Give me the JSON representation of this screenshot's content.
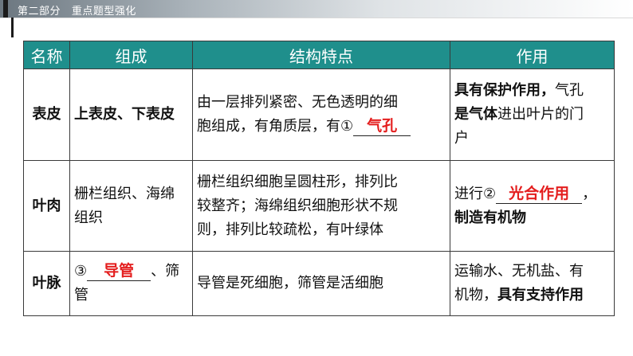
{
  "header": {
    "section": "第二部分",
    "subtitle": "重点题型强化"
  },
  "table": {
    "columns": [
      "名称",
      "组成",
      "结构特点",
      "作用"
    ],
    "rows": [
      {
        "name": "表皮",
        "composition": "上表皮、下表皮",
        "structure_line1": "由一层排列紧密、无色透明的细",
        "structure_line2_prefix": "胞组成，有角质层，有①",
        "structure_answer": "气孔",
        "function_p1": "具有",
        "function_p2": "保护",
        "function_p3": "作用，",
        "function_p4": "气孔",
        "function_line2": "是气体",
        "function_line2b": "进出叶片的门",
        "function_line3": "户"
      },
      {
        "name": "叶肉",
        "composition_line1": "栅栏组织、海绵",
        "composition_line2": "组织",
        "structure_line1": "栅栏组织细胞呈圆柱形，排列比",
        "structure_line2": "较整齐；海绵组织细胞形状不规",
        "structure_line3": "则，排列比较疏松，有叶绿体",
        "function_prefix": "进行②",
        "function_answer": "光合作用",
        "function_suffix": "，",
        "function_line2": "制造有机物"
      },
      {
        "name": "叶脉",
        "composition_prefix": "③",
        "composition_answer": "导管",
        "composition_suffix": "、筛",
        "composition_line2": "管",
        "structure": "导管是死细胞，筛管是活细胞",
        "function_line1": "运输水、无机盐、有",
        "function_line2a": "机物，",
        "function_line2b": "具有支持作用"
      }
    ]
  }
}
